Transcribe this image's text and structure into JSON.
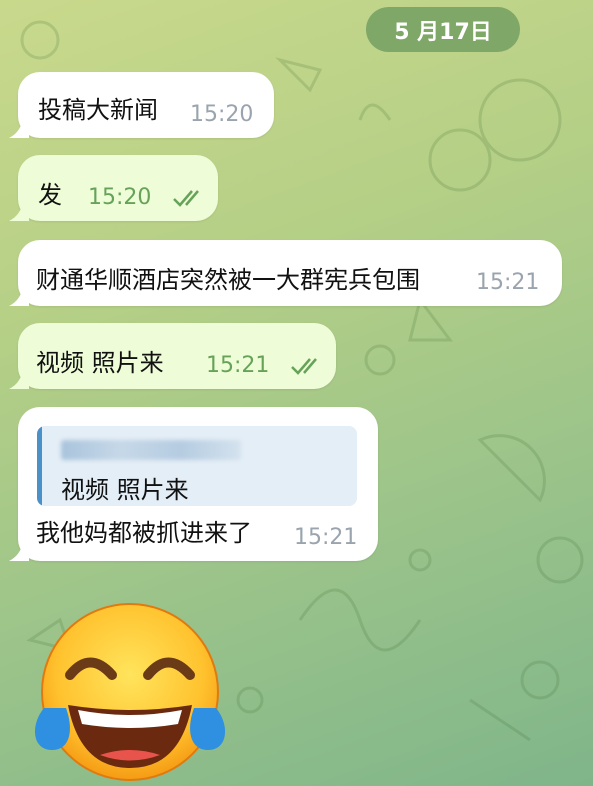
{
  "date_badge": "5 月17日",
  "messages": [
    {
      "text": "投稿大新闻",
      "time": "15:20",
      "direction": "in"
    },
    {
      "text": "发",
      "time": "15:20",
      "direction": "out",
      "read": true
    },
    {
      "text": "财通华顺酒店突然被一大群宪兵包围",
      "time": "15:21",
      "direction": "in"
    },
    {
      "text": "视频  照片来",
      "time": "15:21",
      "direction": "out",
      "read": true
    },
    {
      "reply_quote": "视频  照片来",
      "text": "我他妈都被抓进来了",
      "time": "15:21",
      "direction": "in"
    }
  ],
  "sticker": "tears-of-joy-emoji",
  "colors": {
    "incoming": "#ffffff",
    "outgoing": "#effcd8",
    "date_pill": "#7fa767",
    "time_outgoing": "#66a359",
    "time_incoming": "#9aa4ae",
    "reply_bar": "#4a90c9"
  }
}
